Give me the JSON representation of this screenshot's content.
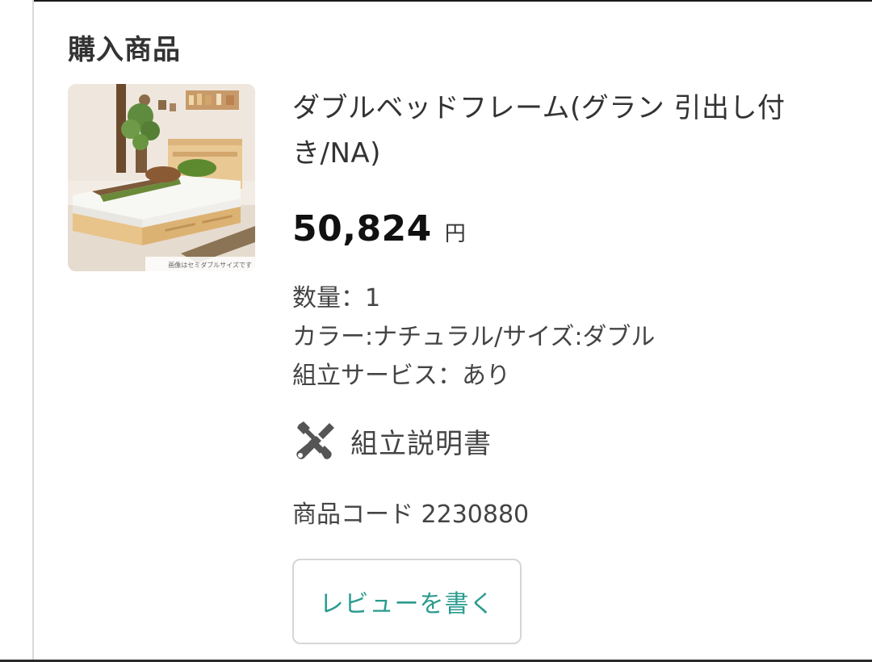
{
  "section": {
    "title": "購入商品"
  },
  "product": {
    "name": "ダブルベッドフレーム(グラン 引出し付き/NA)",
    "image_caption": "画像はセミダブルサイズです",
    "price": "50,824",
    "price_unit": "円",
    "quantity": "数量：1",
    "variant": "カラー:ナチュラル/サイズ:ダブル",
    "assembly_service": "組立サービス：あり",
    "manual_link": "組立説明書",
    "manual_icon": "tools-icon",
    "code": "商品コード 2230880"
  },
  "actions": {
    "review_button": "レビューを書く"
  },
  "colors": {
    "accent": "#2a9b8e",
    "text": "#333333",
    "border": "#d6d6d6"
  }
}
